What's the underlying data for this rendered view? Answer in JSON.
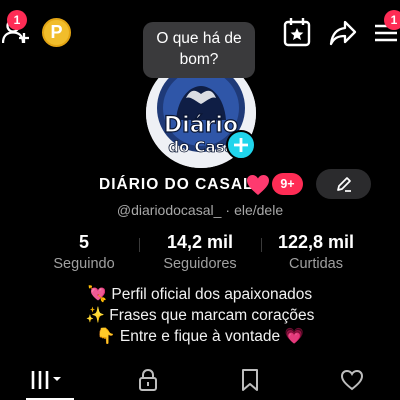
{
  "colors": {
    "accent_pink": "#fe2c55",
    "accent_cyan": "#20d5ec",
    "coin": "#f1bd2b",
    "muted": "#a0a0a0"
  },
  "topbar": {
    "add_user_icon": "add-friend-icon",
    "add_user_badge": "1",
    "coin_label": "P",
    "menu_badge": "1",
    "icons": [
      "calendar-star-icon",
      "share-icon",
      "hamburger-menu-icon"
    ]
  },
  "tooltip": {
    "line1": "O que há de",
    "line2": "bom?"
  },
  "avatar": {
    "logo_line1": "Diário",
    "logo_line2": "do Casal"
  },
  "profile": {
    "display_name": "DIÁRIO DO CASAL",
    "heart_icon": "heart-icon",
    "badge_count": "9+",
    "handle": "@diariodocasal_",
    "pronouns": "ele/dele"
  },
  "stats": {
    "following": {
      "value": "5",
      "label": "Seguindo"
    },
    "followers": {
      "value": "14,2 mil",
      "label": "Seguidores"
    },
    "likes": {
      "value": "122,8 mil",
      "label": "Curtidas"
    }
  },
  "bio": {
    "line1": "💘 Perfil oficial dos apaixonados",
    "line2": "✨ Frases que marcam corações",
    "line3": "👇 Entre e fique à vontade 💗"
  },
  "tabs": [
    "grid-icon",
    "lock-icon",
    "bookmark-icon",
    "heart-outline-icon"
  ]
}
